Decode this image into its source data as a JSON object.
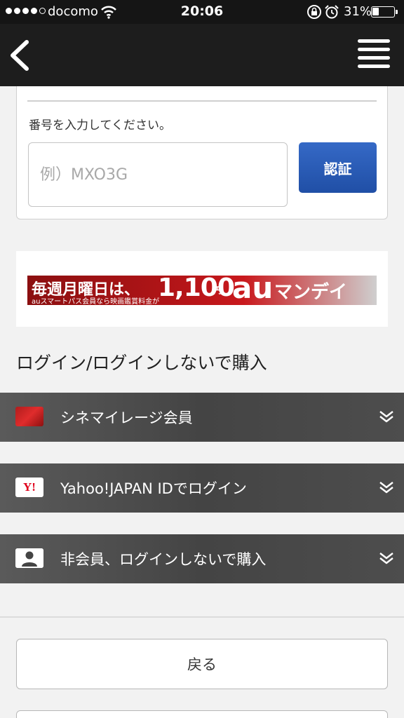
{
  "status_bar": {
    "carrier": "docomo",
    "time": "20:06",
    "battery": "31%",
    "battery_level": 0.31,
    "signal_bars": 4,
    "icons": [
      "signal-icon",
      "wifi-icon",
      "rotation-lock-icon",
      "alarm-icon",
      "battery-icon"
    ]
  },
  "nav": {
    "back_icon": "chevron-left-icon",
    "menu_icon": "hamburger-menu-icon"
  },
  "code_entry": {
    "prompt": "番号を入力してください。",
    "placeholder": "例）MXO3G",
    "value": "",
    "verify_label": "認証"
  },
  "banner": {
    "main_text": "毎週月曜日は、",
    "sub_text": "auスマートパス会員なら映画鑑賞料金が",
    "price": "1,100",
    "yen": "円",
    "brand": "au",
    "campaign": "マンデイ"
  },
  "login_section": {
    "title": "ログイン/ログインしないで購入",
    "options": [
      {
        "label": "シネマイレージ会員",
        "icon": "cinemileage-card-icon"
      },
      {
        "label": "Yahoo!JAPAN IDでログイン",
        "icon": "yahoo-logo-icon",
        "icon_text": "Y!"
      },
      {
        "label": "非会員、ログインしないで購入",
        "icon": "person-icon"
      }
    ],
    "expand_icon": "double-chevron-down-icon"
  },
  "footer": {
    "back_label": "戻る"
  },
  "colors": {
    "nav_bg": "#1d1d1d",
    "accent_blue": "#2a5db8",
    "option_bar": "#4d4d4d",
    "page_bg": "#f2f2f2"
  }
}
